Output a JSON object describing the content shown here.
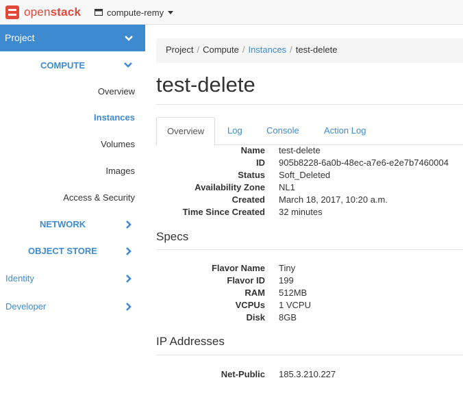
{
  "brand": {
    "name_light": "open",
    "name_bold": "stack",
    "color": "#e0493a"
  },
  "project_picker": {
    "label": "compute-remy",
    "icon": "server-icon"
  },
  "sidebar": {
    "project": {
      "label": "Project"
    },
    "compute": {
      "label": "COMPUTE"
    },
    "compute_items": [
      {
        "label": "Overview",
        "active": false
      },
      {
        "label": "Instances",
        "active": true
      },
      {
        "label": "Volumes",
        "active": false
      },
      {
        "label": "Images",
        "active": false
      },
      {
        "label": "Access & Security",
        "active": false
      }
    ],
    "network": {
      "label": "NETWORK"
    },
    "object_store": {
      "label": "OBJECT STORE"
    },
    "identity": {
      "label": "Identity"
    },
    "developer": {
      "label": "Developer"
    }
  },
  "breadcrumb": {
    "items": [
      "Project",
      "Compute",
      "Instances",
      "test-delete"
    ],
    "separator": "/"
  },
  "page": {
    "title": "test-delete"
  },
  "tabs": [
    {
      "label": "Overview",
      "active": true
    },
    {
      "label": "Log",
      "active": false
    },
    {
      "label": "Console",
      "active": false
    },
    {
      "label": "Action Log",
      "active": false
    }
  ],
  "overview": [
    {
      "key": "Name",
      "value": "test-delete"
    },
    {
      "key": "ID",
      "value": "905b8228-6a0b-48ec-a7e6-e2e7b7460004"
    },
    {
      "key": "Status",
      "value": "Soft_Deleted"
    },
    {
      "key": "Availability Zone",
      "value": "NL1"
    },
    {
      "key": "Created",
      "value": "March 18, 2017, 10:20 a.m."
    },
    {
      "key": "Time Since Created",
      "value": "32 minutes"
    }
  ],
  "specs": {
    "title": "Specs",
    "rows": [
      {
        "key": "Flavor Name",
        "value": "Tiny"
      },
      {
        "key": "Flavor ID",
        "value": "199"
      },
      {
        "key": "RAM",
        "value": "512MB"
      },
      {
        "key": "VCPUs",
        "value": "1 VCPU"
      },
      {
        "key": "Disk",
        "value": "8GB"
      }
    ]
  },
  "ip_addresses": {
    "title": "IP Addresses",
    "rows": [
      {
        "key": "Net-Public",
        "value": "185.3.210.227"
      }
    ]
  },
  "colors": {
    "accent": "#3e8ad0",
    "sidebar_active_bg": "#3e8ad0",
    "logo_red": "#e0493a"
  }
}
